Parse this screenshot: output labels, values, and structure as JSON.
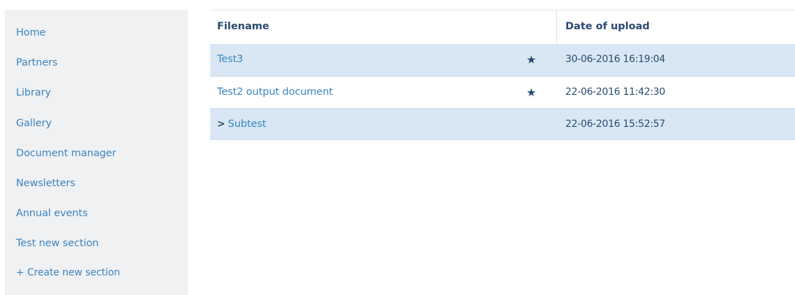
{
  "sidebar": {
    "items": [
      {
        "label": "Home"
      },
      {
        "label": "Partners"
      },
      {
        "label": "Library"
      },
      {
        "label": "Gallery"
      },
      {
        "label": "Document manager"
      },
      {
        "label": "Newsletters"
      },
      {
        "label": "Annual events"
      },
      {
        "label": "Test new section"
      }
    ],
    "create_label": "+ Create new section"
  },
  "table": {
    "headers": {
      "filename": "Filename",
      "date": "Date of upload"
    },
    "rows": [
      {
        "name": "Test3",
        "date": "30-06-2016 16:19:04",
        "starred": true,
        "folder": false
      },
      {
        "name": "Test2 output document",
        "date": "22-06-2016 11:42:30",
        "starred": true,
        "folder": false
      },
      {
        "name": "Subtest",
        "date": "22-06-2016 15:52:57",
        "starred": false,
        "folder": true
      }
    ]
  },
  "icons": {
    "star": "star-icon",
    "chevron": "chevron-right-icon"
  },
  "colors": {
    "link": "#3a84bf",
    "dark_text": "#2a4a70",
    "row_highlight": "#d8e7f3",
    "sidebar_bg": "#f0f1f3"
  }
}
